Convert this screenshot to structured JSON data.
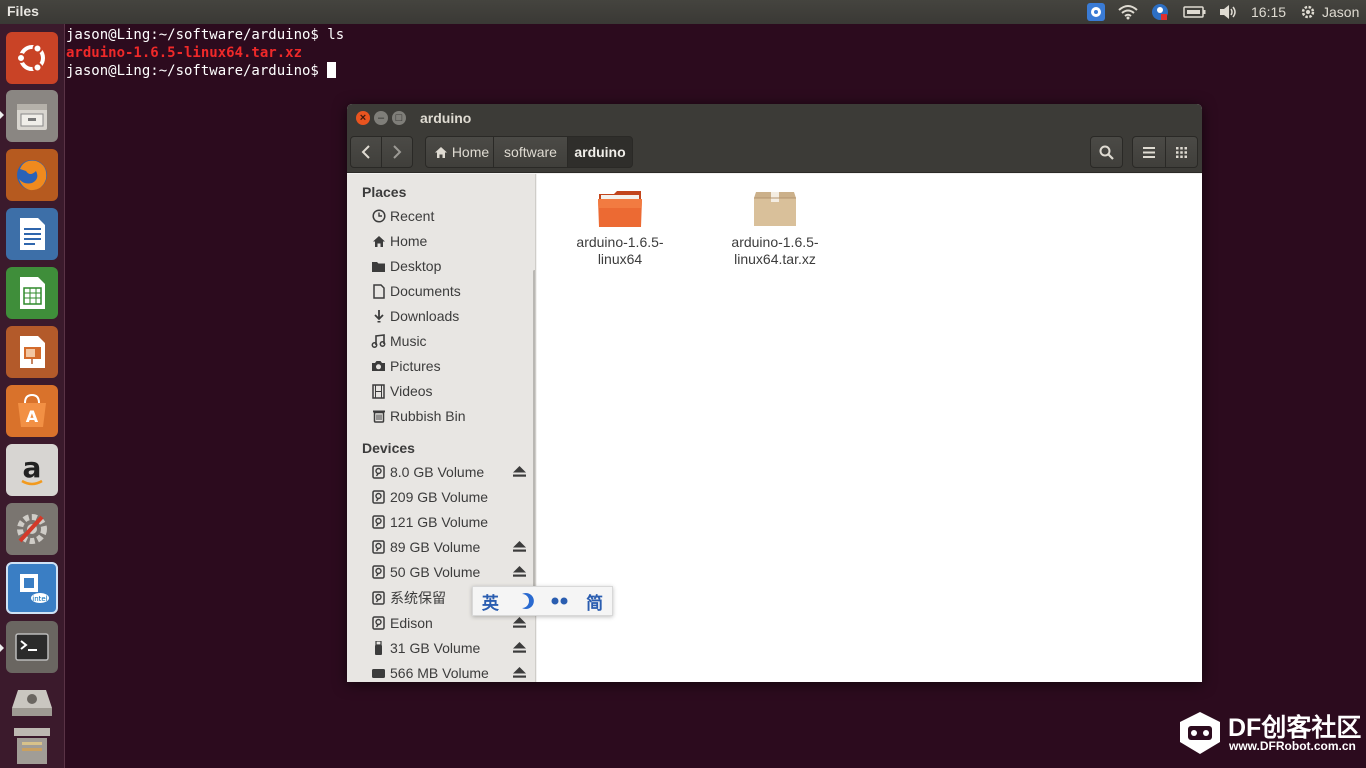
{
  "top_panel": {
    "app_title": "Files",
    "clock": "16:15",
    "user": "Jason"
  },
  "launcher": {
    "items": [
      "dash",
      "files",
      "firefox",
      "writer",
      "calc",
      "impress",
      "software-center",
      "amazon",
      "system-settings",
      "intel-edison",
      "terminal",
      "drive",
      "trash"
    ]
  },
  "terminal": {
    "line1": "jason@Ling:~/software/arduino$ ls",
    "line2": "arduino-1.6.5-linux64.tar.xz",
    "line3": "jason@Ling:~/software/arduino$ "
  },
  "window": {
    "title": "arduino",
    "breadcrumbs": [
      "Home",
      "software",
      "arduino"
    ],
    "sidebar": {
      "places_heading": "Places",
      "places": [
        {
          "label": "Recent",
          "icon": "clock-icon"
        },
        {
          "label": "Home",
          "icon": "home-icon"
        },
        {
          "label": "Desktop",
          "icon": "folder-icon"
        },
        {
          "label": "Documents",
          "icon": "document-icon"
        },
        {
          "label": "Downloads",
          "icon": "download-icon"
        },
        {
          "label": "Music",
          "icon": "music-icon"
        },
        {
          "label": "Pictures",
          "icon": "camera-icon"
        },
        {
          "label": "Videos",
          "icon": "film-icon"
        },
        {
          "label": "Rubbish Bin",
          "icon": "trash-icon"
        }
      ],
      "devices_heading": "Devices",
      "devices": [
        {
          "label": "8.0 GB Volume",
          "eject": true
        },
        {
          "label": "209 GB Volume",
          "eject": false
        },
        {
          "label": "121 GB Volume",
          "eject": false
        },
        {
          "label": "89 GB Volume",
          "eject": true
        },
        {
          "label": "50 GB Volume",
          "eject": true
        },
        {
          "label": "系统保留",
          "eject": false
        },
        {
          "label": "Edison",
          "eject": true
        },
        {
          "label": "31 GB Volume",
          "eject": true
        },
        {
          "label": "566 MB Volume",
          "eject": true
        }
      ]
    },
    "files": [
      {
        "line1": "arduino-1.6.5-",
        "line2": "linux64",
        "icon": "folder-icon"
      },
      {
        "line1": "arduino-1.6.5-",
        "line2": "linux64.tar.xz",
        "icon": "archive-icon"
      }
    ]
  },
  "ime": {
    "mode": "英",
    "variant": "简"
  },
  "watermark": {
    "title": "DF创客社区",
    "url": "www.DFRobot.com.cn"
  },
  "colors": {
    "desktop": "#2c0b1e",
    "launcher": "#3b1a2c",
    "panel": "#3c3b37",
    "accent_orange": "#e9541f",
    "terminal_red": "#ef2929"
  }
}
